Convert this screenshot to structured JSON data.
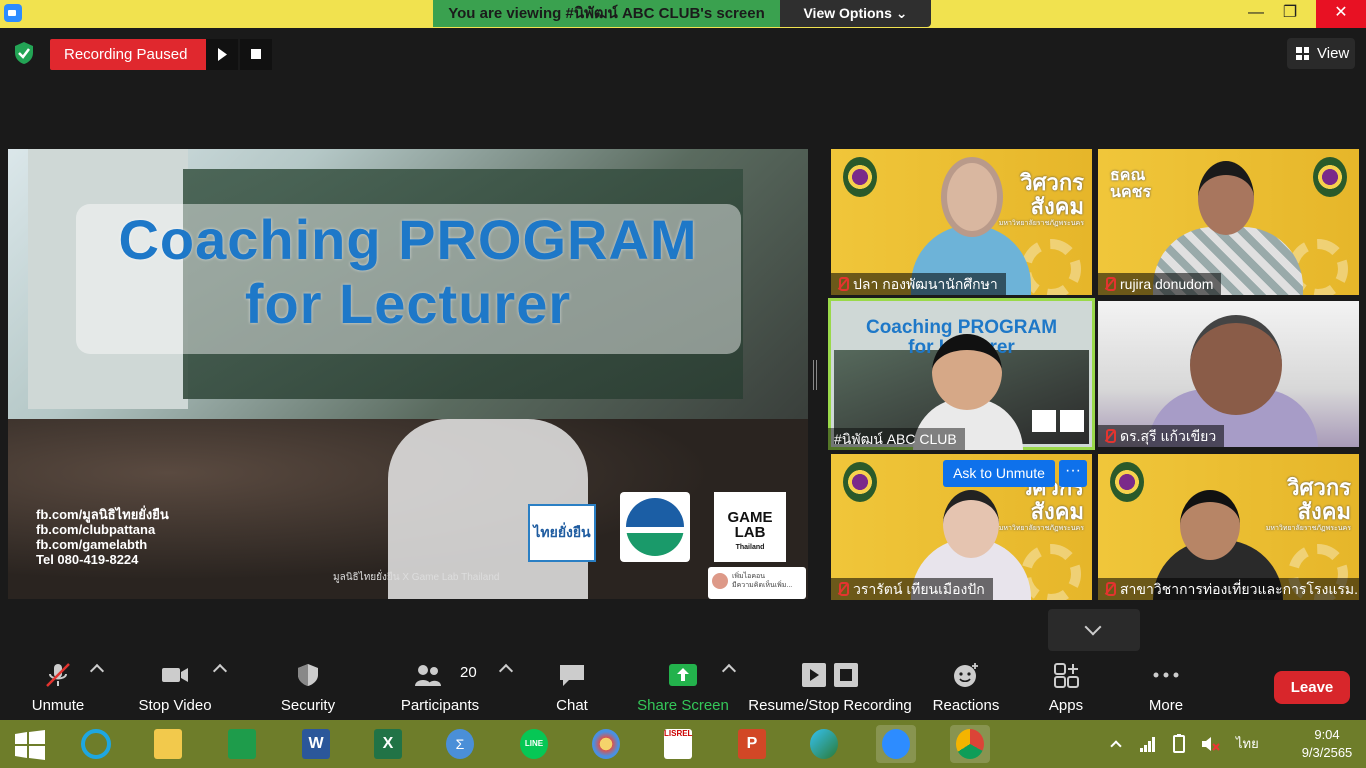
{
  "window": {
    "viewing_banner": "You are viewing #นิพัฒน์ ABC CLUB's screen",
    "view_options": "View Options",
    "minimize": "—",
    "maximize": "❐",
    "close": "✕"
  },
  "recording": {
    "status": "Recording Paused"
  },
  "view_button": "View",
  "shared_slide": {
    "title_line1": "Coaching PROGRAM",
    "title_line2": "for Lecturer",
    "contacts": [
      "fb.com/มูลนิธิไทยยั่งยืน",
      "fb.com/clubpattana",
      "fb.com/gamelabth",
      "Tel 080-419-8224"
    ],
    "credit": "มูลนิธิไทยยั่งยืน X Game Lab Thailand",
    "logo_a": "ไทยยั่งยืน",
    "logo_c_line1": "GAME",
    "logo_c_line2": "LAB",
    "logo_c_sub": "Thailand",
    "comment_name": "เพิ่มไอคอน",
    "comment_text": "มีความคิดเห็นเพิ่ม..."
  },
  "brand": {
    "line1": "วิศวกร",
    "line2": "สังคม",
    "sub": "มหาวิทยาลัยราชภัฏพระนคร",
    "alt1": "ธคณ",
    "alt2": "นคชร"
  },
  "participants": [
    {
      "name": "ปลา  กองพัฒนานักศึกษา"
    },
    {
      "name": "rujira donudom"
    },
    {
      "name": "#นิพัฒน์ ABC CLUB"
    },
    {
      "name": "ดร.สุรี  แก้วเขียว"
    },
    {
      "name": "วรารัตน์ เทียนเมืองปัก"
    },
    {
      "name": "สาขาวิชาการท่องเที่ยวและการโรงแรม..."
    }
  ],
  "popover": {
    "ask_unmute": "Ask to Unmute",
    "more": "···"
  },
  "active_tile_slide": {
    "line1": "Coaching PROGRAM",
    "line2": "for Lecturer"
  },
  "toolbar": {
    "unmute": "Unmute",
    "stop_video": "Stop Video",
    "security": "Security",
    "participants": "Participants",
    "participants_count": "20",
    "chat": "Chat",
    "share_screen": "Share Screen",
    "resume_stop_recording": "Resume/Stop Recording",
    "reactions": "Reactions",
    "apps": "Apps",
    "more": "More",
    "leave": "Leave"
  },
  "taskbar": {
    "language": "ไทย",
    "time": "9:04",
    "date": "9/3/2565",
    "lisrel_label": "LISREL"
  },
  "colors": {
    "titlebar": "#f1e24f",
    "banner_green": "#3aa14f",
    "record_red": "#e0282e",
    "leave_red": "#d8262b",
    "zoom_blue": "#0e71eb",
    "share_green": "#34c759",
    "tile_yellow": "#f0c63a",
    "taskbar": "#6e7d2a"
  }
}
